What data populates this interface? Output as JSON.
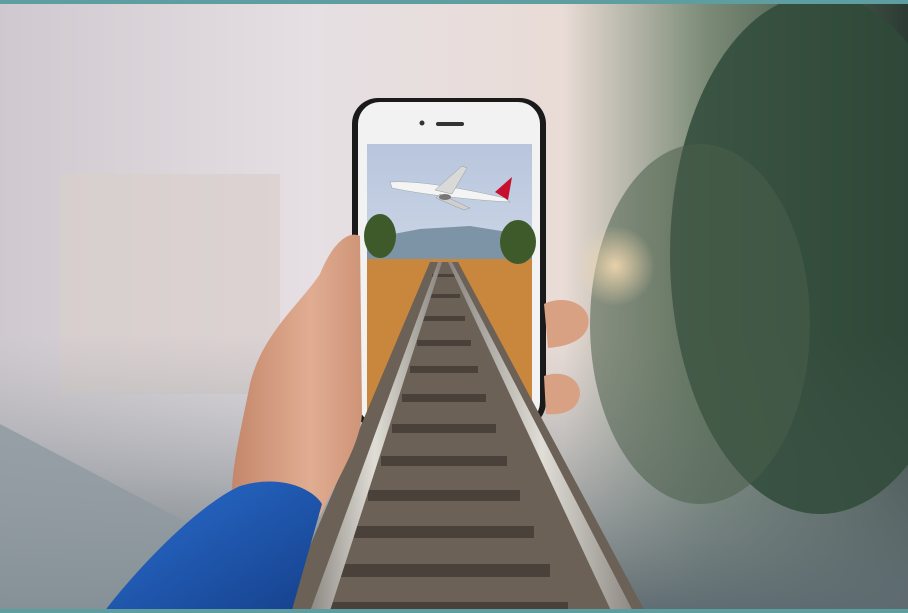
{
  "image": {
    "frame_color": "#5f9ea0",
    "sky_color": "#e9dfe4",
    "foliage_color": "#2f4a3a",
    "sleeve_color": "#1f5db8",
    "skin_color": "#d9a184",
    "phone_bezel_color": "#f2f2f2",
    "phone_case_color": "#1a1a1a",
    "airplane_livery_color": "#c8102e",
    "rail_color": "#b9b6b0",
    "ballast_color": "#6b6156",
    "grass_color": "#c9873e"
  }
}
